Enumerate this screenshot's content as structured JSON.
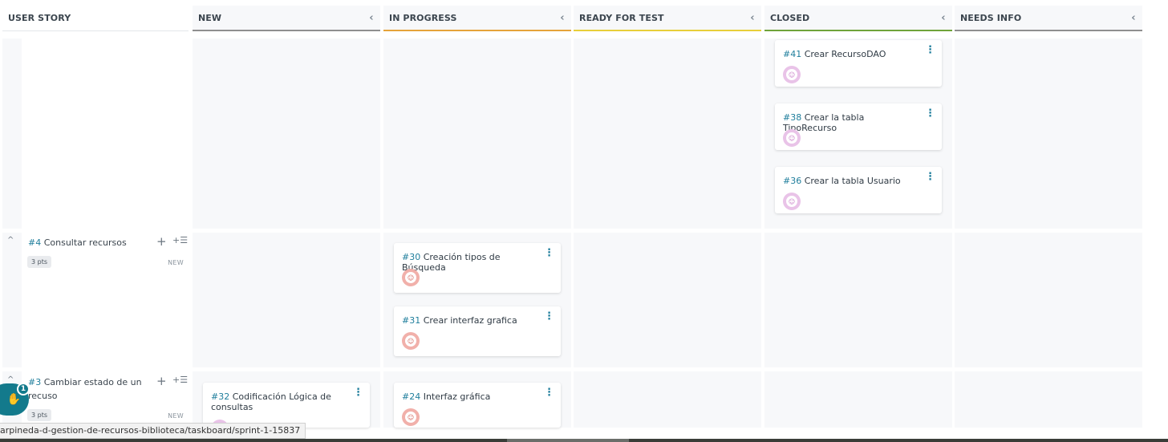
{
  "headers": {
    "user_story": "USER STORY",
    "columns": [
      {
        "label": "NEW",
        "color": "#8f8f8f"
      },
      {
        "label": "IN PROGRESS",
        "color": "#e5a33a"
      },
      {
        "label": "READY FOR TEST",
        "color": "#e8cf3a"
      },
      {
        "label": "CLOSED",
        "color": "#6fa33a"
      },
      {
        "label": "NEEDS INFO",
        "color": "#8f8f8f"
      }
    ],
    "collapse_glyph": "‹"
  },
  "stories": [
    {
      "ref": "#4",
      "title": "Consultar recursos",
      "points": "3 pts",
      "status": "NEW"
    },
    {
      "ref": "#3",
      "title": "Cambiar estado de un recuso",
      "points": "3 pts",
      "status": "NEW"
    }
  ],
  "tasks": {
    "closed_unassigned": [
      {
        "ref": "#41",
        "title": "Crear RecursoDAO"
      },
      {
        "ref": "#38",
        "title": "Crear la tabla TipoRecurso"
      },
      {
        "ref": "#36",
        "title": "Crear la tabla Usuario"
      }
    ],
    "story4_in_progress": [
      {
        "ref": "#30",
        "title": "Creación tipos de Búsqueda"
      },
      {
        "ref": "#31",
        "title": "Crear interfaz grafica"
      }
    ],
    "story3_new": [
      {
        "ref": "#32",
        "title": "Codificación Lógica de consultas"
      }
    ],
    "story3_in_progress": [
      {
        "ref": "#24",
        "title": "Interfaz gráfica"
      }
    ]
  },
  "ui": {
    "menu_glyph": "⋮",
    "plus_glyph": "+",
    "addlist_glyph": "+☰",
    "caret_glyph": "^",
    "avatar_glyph": "☺",
    "chat_glyph": "✋",
    "chat_badge": "1"
  },
  "status_url": "arpineda-d-gestion-de-recursos-biblioteca/taskboard/sprint-1-15837"
}
